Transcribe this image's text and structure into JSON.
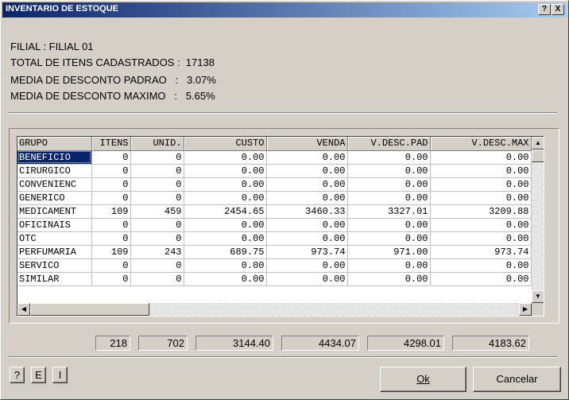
{
  "window": {
    "title": "INVENTARIO DE ESTOQUE",
    "help_btn": "?",
    "close_btn": "X"
  },
  "info": {
    "filial": "FILIAL : FILIAL 01",
    "total_itens": "TOTAL DE ITENS CADASTRADOS :  17138",
    "media_padrao": "MEDIA DE DESCONTO PADRAO   :   3.07%",
    "media_maximo": "MEDIA DE DESCONTO MAXIMO   :   5.65%"
  },
  "grid": {
    "columns": [
      "GRUPO",
      "ITENS",
      "UNID.",
      "CUSTO",
      "VENDA",
      "V.DESC.PAD",
      "V.DESC.MAX"
    ],
    "rows": [
      [
        "BENEFICIO",
        "0",
        "0",
        "0.00",
        "0.00",
        "0.00",
        "0.00"
      ],
      [
        "CIRURGICO",
        "0",
        "0",
        "0.00",
        "0.00",
        "0.00",
        "0.00"
      ],
      [
        "CONVENIENC",
        "0",
        "0",
        "0.00",
        "0.00",
        "0.00",
        "0.00"
      ],
      [
        "GENERICO",
        "0",
        "0",
        "0.00",
        "0.00",
        "0.00",
        "0.00"
      ],
      [
        "MEDICAMENT",
        "109",
        "459",
        "2454.65",
        "3460.33",
        "3327.01",
        "3209.88"
      ],
      [
        "OFICINAIS",
        "0",
        "0",
        "0.00",
        "0.00",
        "0.00",
        "0.00"
      ],
      [
        "OTC",
        "0",
        "0",
        "0.00",
        "0.00",
        "0.00",
        "0.00"
      ],
      [
        "PERFUMARIA",
        "109",
        "243",
        "689.75",
        "973.74",
        "971.00",
        "973.74"
      ],
      [
        "SERVICO",
        "0",
        "0",
        "0.00",
        "0.00",
        "0.00",
        "0.00"
      ],
      [
        "SIMILAR",
        "0",
        "0",
        "0.00",
        "0.00",
        "0.00",
        "0.00"
      ]
    ],
    "selected_cell": "BENEFICIO"
  },
  "totals": [
    "218",
    "702",
    "3144.40",
    "4434.07",
    "4298.01",
    "4183.62"
  ],
  "buttons": {
    "help": "?",
    "e": "E",
    "i": "I",
    "ok": "Ok",
    "cancel": "Cancelar"
  },
  "colors": {
    "title_start": "#0a246a",
    "title_end": "#a6caf0",
    "face": "#d4d0c8",
    "selection": "#0a246a"
  }
}
